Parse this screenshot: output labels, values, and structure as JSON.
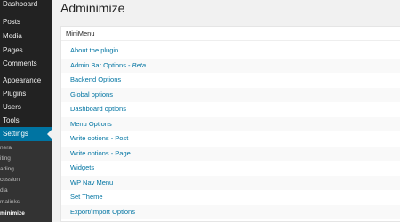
{
  "sidebar": {
    "items": [
      {
        "id": "dashboard",
        "label": "Dashboard"
      },
      {
        "id": "posts",
        "label": "Posts"
      },
      {
        "id": "media",
        "label": "Media"
      },
      {
        "id": "pages",
        "label": "Pages"
      },
      {
        "id": "comments",
        "label": "Comments"
      },
      {
        "id": "appearance",
        "label": "Appearance"
      },
      {
        "id": "plugins",
        "label": "Plugins"
      },
      {
        "id": "users",
        "label": "Users"
      },
      {
        "id": "tools",
        "label": "Tools"
      },
      {
        "id": "settings",
        "label": "Settings",
        "current": true
      }
    ],
    "submenu": [
      {
        "id": "general",
        "label": "neral"
      },
      {
        "id": "writing",
        "label": "iting"
      },
      {
        "id": "reading",
        "label": "ading"
      },
      {
        "id": "discussion",
        "label": "cussion"
      },
      {
        "id": "media",
        "label": "dia"
      },
      {
        "id": "permalinks",
        "label": "malinks"
      },
      {
        "id": "adminimize",
        "label": "minimize",
        "current": true
      }
    ]
  },
  "main": {
    "title": "Adminimize",
    "panel": {
      "heading": "MiniMenu",
      "options": [
        {
          "label": "About the plugin"
        },
        {
          "label": "Admin Bar Options - ",
          "badge": "Beta"
        },
        {
          "label": "Backend Options"
        },
        {
          "label": "Global options"
        },
        {
          "label": "Dashboard options"
        },
        {
          "label": "Menu Options"
        },
        {
          "label": "Write options - Post"
        },
        {
          "label": "Write options - Page"
        },
        {
          "label": "Widgets"
        },
        {
          "label": "WP Nav Menu"
        },
        {
          "label": "Set Theme"
        },
        {
          "label": "Export/Import Options"
        }
      ]
    }
  },
  "colors": {
    "sidebar_bg": "#222222",
    "submenu_bg": "#333333",
    "accent": "#0074a2",
    "page_bg": "#f1f1f1",
    "link": "#0074a2"
  }
}
